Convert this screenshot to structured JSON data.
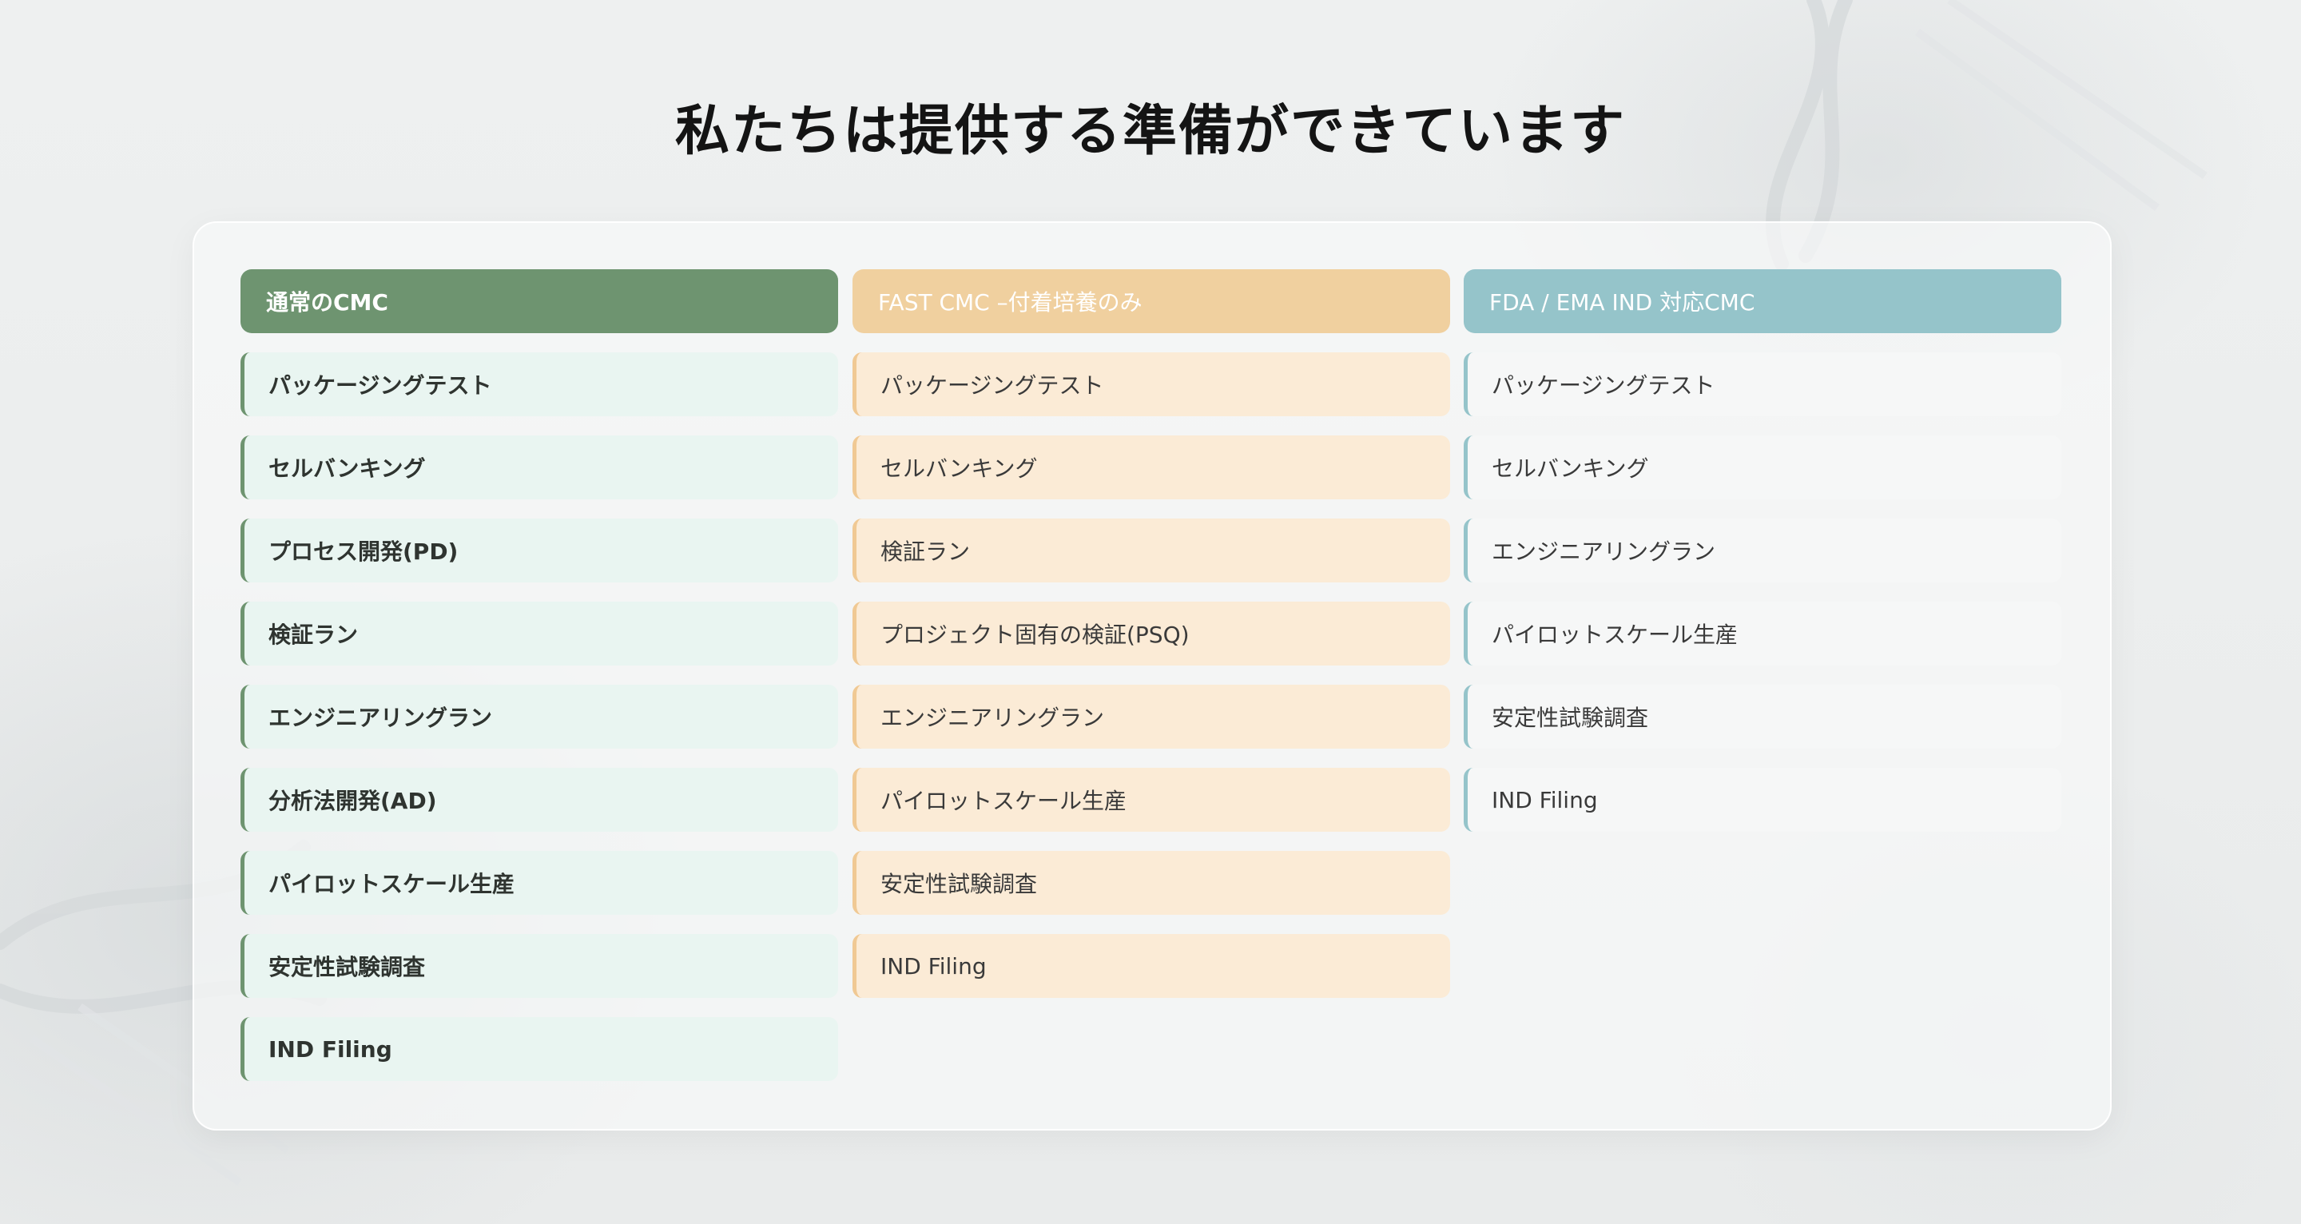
{
  "page": {
    "title": "私たちは提供する準備ができています"
  },
  "columns": [
    {
      "header": "通常のCMC",
      "color": "#6e9470",
      "items": [
        "パッケージングテスト",
        "セルバンキング",
        "プロセス開発(PD)",
        "検証ラン",
        "エンジニアリングラン",
        "分析法開発(AD)",
        "パイロットスケール生産",
        "安定性試験調査",
        "IND Filing"
      ]
    },
    {
      "header": "FAST CMC –付着培養のみ",
      "color": "#f0d09f",
      "items": [
        "パッケージングテスト",
        "セルバンキング",
        "検証ラン",
        "プロジェクト固有の検証(PSQ)",
        "エンジニアリングラン",
        "パイロットスケール生産",
        "安定性試験調査",
        "IND Filing"
      ]
    },
    {
      "header": "FDA / EMA IND 対応CMC",
      "color": "#95c4ca",
      "items": [
        "パッケージングテスト",
        "セルバンキング",
        "エンジニアリングラン",
        "パイロットスケール生産",
        "安定性試験調査",
        "IND Filing"
      ]
    }
  ]
}
